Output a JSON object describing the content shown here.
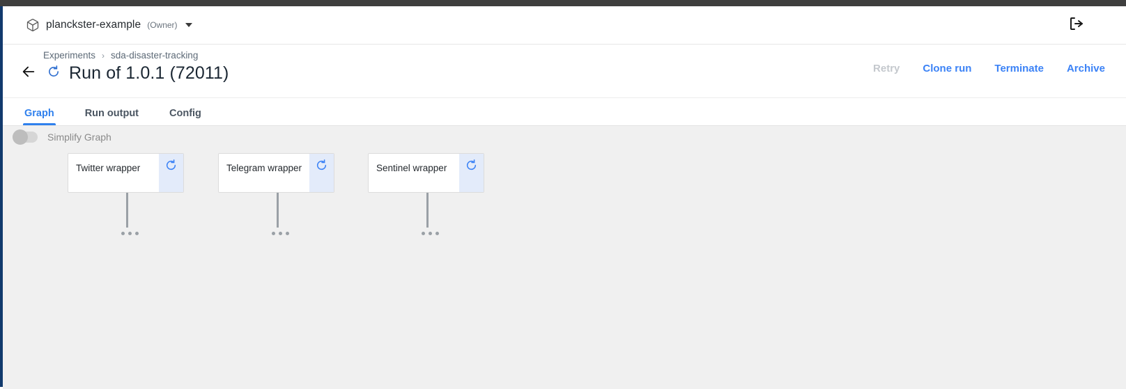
{
  "chrome": {
    "workspace_name": "planckster-example",
    "workspace_role": "(Owner)",
    "caret_icon": "chevron-down-icon",
    "package_icon": "package-icon",
    "logout_icon": "logout-icon"
  },
  "breadcrumb": {
    "items": [
      "Experiments",
      "sda-disaster-tracking"
    ],
    "separator": "›"
  },
  "run_header": {
    "back_icon": "arrow-left-icon",
    "status_icon": "refresh-spinner-icon",
    "title": "Run of 1.0.1 (72011)",
    "actions": [
      {
        "label": "Retry",
        "disabled": true
      },
      {
        "label": "Clone run",
        "disabled": false
      },
      {
        "label": "Terminate",
        "disabled": false
      },
      {
        "label": "Archive",
        "disabled": false
      }
    ]
  },
  "tabs": [
    {
      "label": "Graph",
      "active": true
    },
    {
      "label": "Run output",
      "active": false
    },
    {
      "label": "Config",
      "active": false
    }
  ],
  "graph": {
    "simplify_toggle": {
      "label": "Simplify Graph",
      "on": false
    },
    "nodes": [
      {
        "label": "Twitter wrapper",
        "status_icon": "refresh-spinner-icon"
      },
      {
        "label": "Telegram wrapper",
        "status_icon": "refresh-spinner-icon"
      },
      {
        "label": "Sentinel wrapper",
        "status_icon": "refresh-spinner-icon"
      }
    ],
    "ellipsis_glyph": "•••"
  },
  "colors": {
    "accent_blue": "#2f80ed",
    "action_blue": "#3b82f6",
    "disabled_gray": "#c4c8cd",
    "node_status_bg": "#e3ebfa",
    "canvas_bg": "#f0f0f0",
    "top_strip": "#3f3f3e",
    "left_rail": "#123a6d"
  }
}
